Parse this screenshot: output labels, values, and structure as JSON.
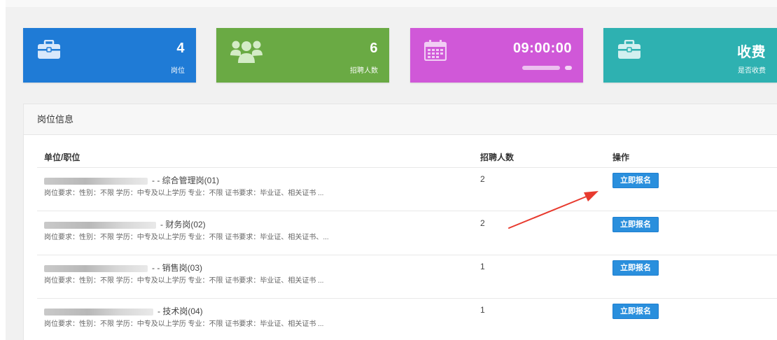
{
  "stats": [
    {
      "value": "4",
      "label": "岗位",
      "icon": "briefcase-icon",
      "color": "#1f7bd6"
    },
    {
      "value": "6",
      "label": "招聘人数",
      "icon": "users-icon",
      "color": "#6aaa44"
    },
    {
      "value": "09:00:00",
      "label": "",
      "icon": "calendar-icon",
      "color": "#d058d8"
    },
    {
      "value": "收费",
      "label": "是否收费",
      "icon": "briefcase-icon",
      "color": "#2eb1b1"
    }
  ],
  "panel": {
    "title": "岗位信息",
    "columns": {
      "unit": "单位/职位",
      "count": "招聘人数",
      "action": "操作"
    },
    "rows": [
      {
        "title": "- - 综合管理岗(01)",
        "requirement": "岗位要求：性别：不限 学历：中专及以上学历 专业：不限 证书要求：毕业证、相关证书 ...",
        "count": "2",
        "action": "立即报名"
      },
      {
        "title": "- 财务岗(02)",
        "requirement": "岗位要求：性别：不限 学历：中专及以上学历 专业：不限 证书要求：毕业证、相关证书、...",
        "count": "2",
        "action": "立即报名"
      },
      {
        "title": "- - 销售岗(03)",
        "requirement": "岗位要求：性别：不限 学历：中专及以上学历 专业：不限 证书要求：毕业证、相关证书 ...",
        "count": "1",
        "action": "立即报名"
      },
      {
        "title": "- 技术岗(04)",
        "requirement": "岗位要求：性别：不限 学历：中专及以上学历 专业：不限 证书要求：毕业证、相关证书 ...",
        "count": "1",
        "action": "立即报名"
      }
    ]
  },
  "annotation_color": "#e83a2e"
}
